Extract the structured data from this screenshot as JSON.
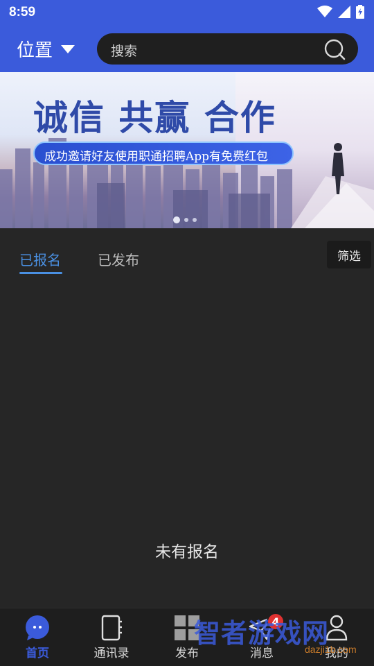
{
  "status_bar": {
    "time": "8:59"
  },
  "header": {
    "location_label": "位置",
    "search_placeholder": "搜索"
  },
  "banner": {
    "title": "诚信 共赢 合作",
    "subtitle": "成功邀请好友使用职通招聘App有免费红包",
    "slides_count": 3,
    "active_slide": 0
  },
  "tabs": [
    {
      "label": "已报名",
      "active": true
    },
    {
      "label": "已发布",
      "active": false
    }
  ],
  "filter_label": "筛选",
  "empty_message": "未有报名",
  "bottom_nav": [
    {
      "label": "首页",
      "icon": "chat-bubble-icon",
      "active": true
    },
    {
      "label": "通讯录",
      "icon": "contacts-book-icon",
      "active": false
    },
    {
      "label": "发布",
      "icon": "grid-icon",
      "active": false
    },
    {
      "label": "消息",
      "icon": "paper-plane-icon",
      "active": false,
      "badge": "4"
    },
    {
      "label": "我的",
      "icon": "person-icon",
      "active": false
    }
  ],
  "watermark": {
    "text": "智者游戏网",
    "sub": "dazji1b.com"
  },
  "colors": {
    "brand": "#3b5bdb",
    "accent": "#4a90e2",
    "badge": "#e03131"
  }
}
